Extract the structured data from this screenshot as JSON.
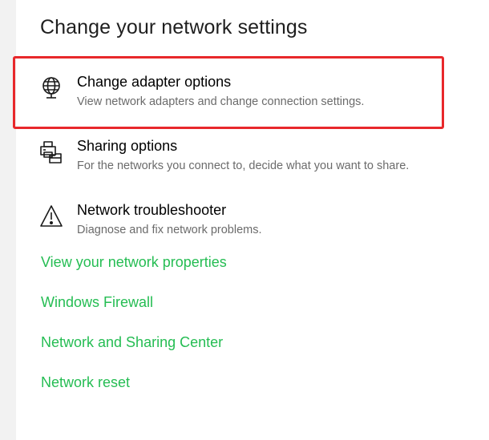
{
  "section": {
    "title": "Change your network settings"
  },
  "options": [
    {
      "label": "Change adapter options",
      "description": "View network adapters and change connection settings.",
      "icon": "globe-monitor-icon"
    },
    {
      "label": "Sharing options",
      "description": "For the networks you connect to, decide what you want to share.",
      "icon": "sharing-printer-icon"
    },
    {
      "label": "Network troubleshooter",
      "description": "Diagnose and fix network problems.",
      "icon": "warning-triangle-icon"
    }
  ],
  "links": [
    "View your network properties",
    "Windows Firewall",
    "Network and Sharing Center",
    "Network reset"
  ],
  "colors": {
    "link": "#25bd53",
    "highlight": "#e8282b",
    "description": "#6b6b6b"
  }
}
